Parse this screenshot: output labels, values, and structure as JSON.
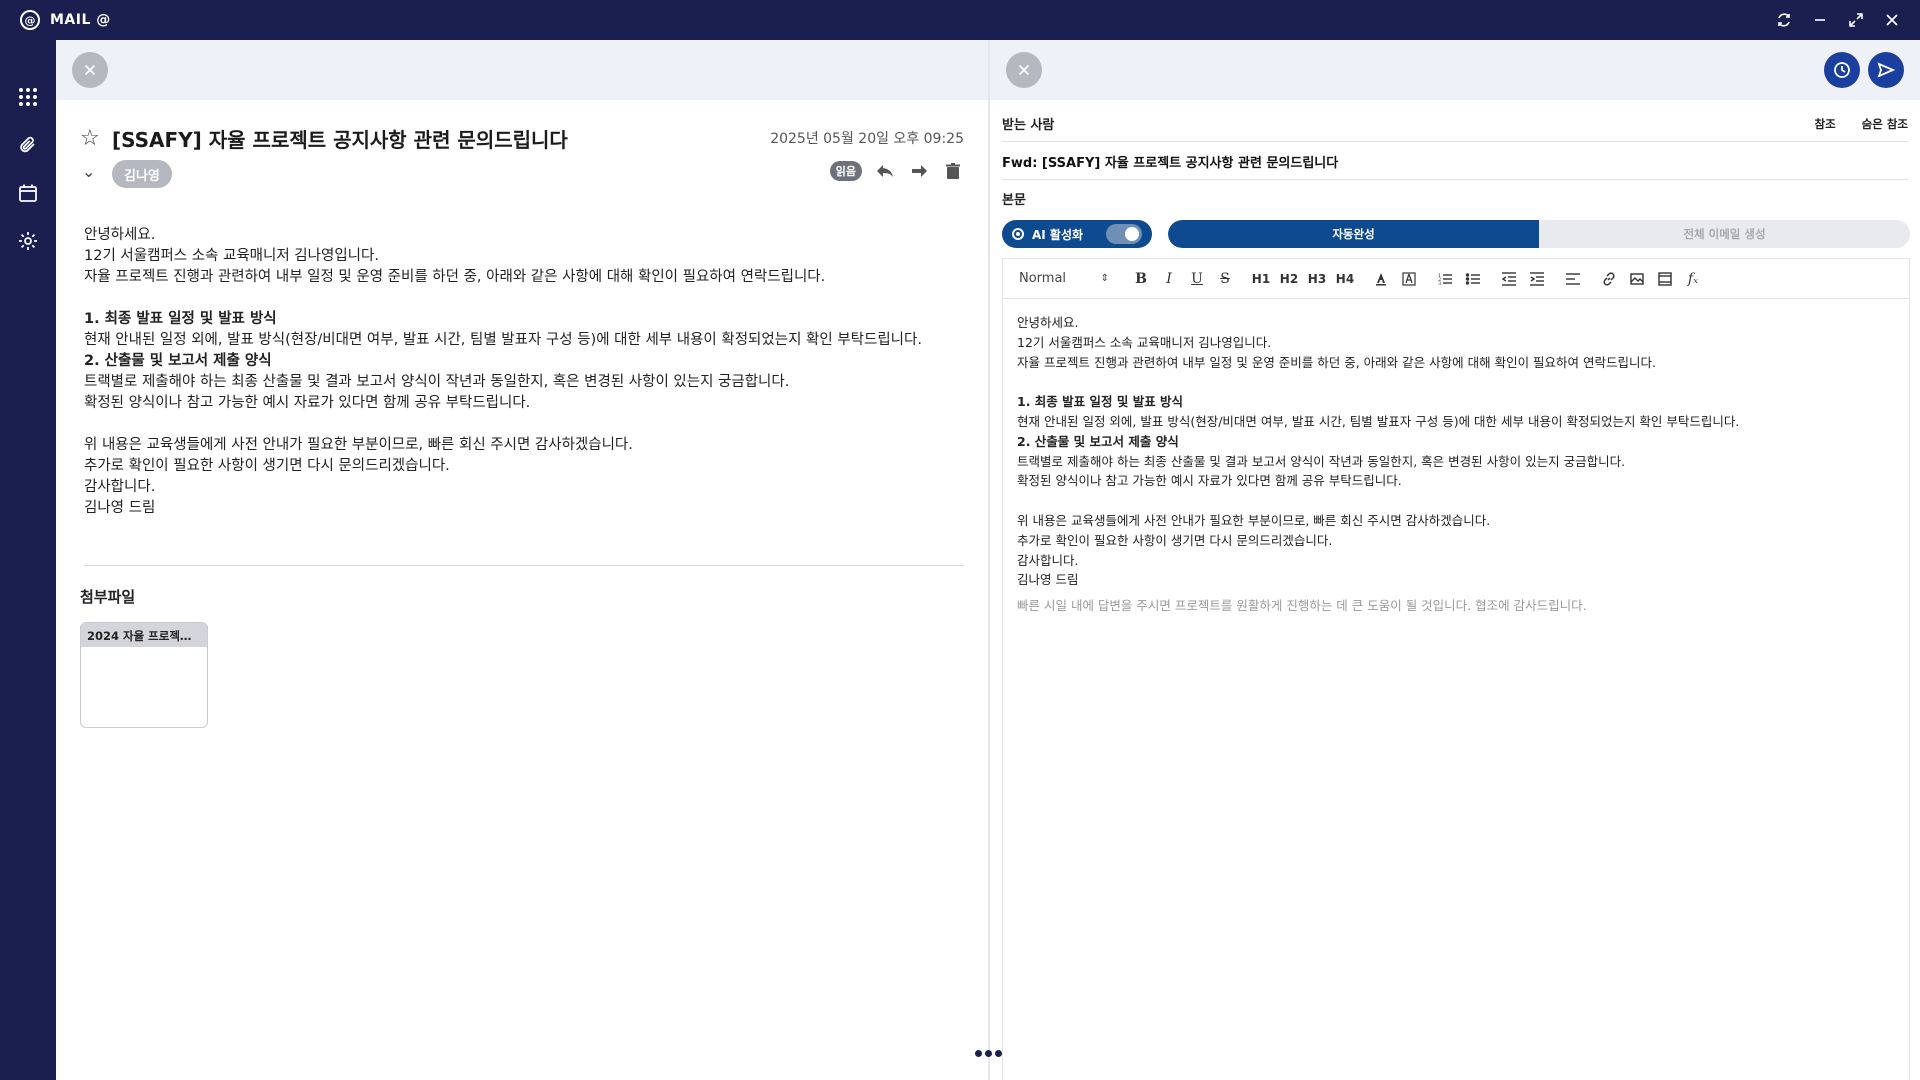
{
  "app": {
    "title": "MAIL @",
    "logo": "@"
  },
  "window_controls": [
    "refresh-icon",
    "minimize-icon",
    "maximize-icon",
    "close-icon"
  ],
  "rail": [
    "apps-grid-icon",
    "paperclip-icon",
    "calendar-icon",
    "gear-icon"
  ],
  "mail": {
    "subject": "[SSAFY] 자율 프로젝트 공지사항 관련 문의드립니다",
    "date": "2025년 05월 20일 오후 09:25",
    "sender": "김나영",
    "read_badge": "읽음",
    "body": [
      {
        "text": "안녕하세요.",
        "bold": false
      },
      {
        "text": "12기 서울캠퍼스 소속 교육매니저 김나영입니다.",
        "bold": false
      },
      {
        "text": "자율 프로젝트 진행과 관련하여 내부 일정 및 운영 준비를 하던 중, 아래와 같은 사항에 대해 확인이 필요하여 연락드립니다.",
        "bold": false
      },
      {
        "text": "",
        "bold": false
      },
      {
        "text": "1. 최종 발표 일정 및 발표 방식",
        "bold": true
      },
      {
        "text": "현재 안내된 일정 외에, 발표 방식(현장/비대면 여부, 발표 시간, 팀별 발표자 구성 등)에 대한 세부 내용이 확정되었는지 확인 부탁드립니다.",
        "bold": false
      },
      {
        "text": "2. 산출물 및 보고서 제출 양식",
        "bold": true
      },
      {
        "text": "트랙별로 제출해야 하는 최종 산출물 및 결과 보고서 양식이 작년과 동일한지, 혹은 변경된 사항이 있는지 궁금합니다.",
        "bold": false
      },
      {
        "text": "확정된 양식이나 참고 가능한 예시 자료가 있다면 함께 공유 부탁드립니다.",
        "bold": false
      },
      {
        "text": "",
        "bold": false
      },
      {
        "text": "위 내용은 교육생들에게 사전 안내가 필요한 부분이므로, 빠른 회신 주시면 감사하겠습니다.",
        "bold": false
      },
      {
        "text": "추가로 확인이 필요한 사항이 생기면 다시 문의드리겠습니다.",
        "bold": false
      },
      {
        "text": "감사합니다.",
        "bold": false
      },
      {
        "text": "김나영 드림",
        "bold": false
      }
    ],
    "attachments_title": "첨부파일",
    "attachments": [
      {
        "name": "2024 자율 프로젝트 ..."
      }
    ]
  },
  "compose": {
    "to_label": "받는 사람",
    "cc_label": "참조",
    "bcc_label": "숨은 참조",
    "subject": "Fwd: [SSAFY] 자율 프로젝트 공지사항 관련 문의드립니다",
    "body_label": "본문",
    "ai_toggle_label": "AI 활성화",
    "ai_enabled": true,
    "tab_autocomplete": "자동완성",
    "tab_full_generate": "전체 이메일 생성",
    "format_select": "Normal",
    "toolbar_headings": [
      "H1",
      "H2",
      "H3",
      "H4"
    ],
    "editor_lines": [
      {
        "text": "안녕하세요.",
        "bold": false
      },
      {
        "text": " 12기 서울캠퍼스 소속 교육매니저 김나영입니다.",
        "bold": false
      },
      {
        "text": "자율 프로젝트 진행과 관련하여 내부 일정 및 운영 준비를 하던 중, 아래와 같은 사항에 대해 확인이 필요하여 연락드립니다.",
        "bold": false
      },
      {
        "text": "",
        "bold": false
      },
      {
        "text": "1. 최종 발표 일정 및 발표 방식",
        "bold": true
      },
      {
        "text": " 현재 안내된 일정 외에, 발표 방식(현장/비대면 여부, 발표 시간, 팀별 발표자 구성 등)에 대한 세부 내용이 확정되었는지 확인 부탁드립니다.",
        "bold": false
      },
      {
        "text": "2. 산출물 및 보고서 제출 양식",
        "bold": true
      },
      {
        "text": " 트랙별로 제출해야 하는 최종 산출물 및 결과 보고서 양식이 작년과 동일한지, 혹은 변경된 사항이 있는지 궁금합니다.",
        "bold": false
      },
      {
        "text": " 확정된 양식이나 참고 가능한 예시 자료가 있다면 함께 공유 부탁드립니다.",
        "bold": false
      },
      {
        "text": "",
        "bold": false
      },
      {
        "text": "위 내용은 교육생들에게 사전 안내가 필요한 부분이므로, 빠른 회신 주시면 감사하겠습니다.",
        "bold": false
      },
      {
        "text": " 추가로 확인이 필요한 사항이 생기면 다시 문의드리겠습니다.",
        "bold": false
      },
      {
        "text": "감사합니다.",
        "bold": false
      },
      {
        "text": " 김나영 드림",
        "bold": false
      }
    ],
    "ai_suggestion": "빠른 시일 내에 답변을 주시면 프로젝트를 원활하게 진행하는 데 큰 도움이 될 것입니다. 협조에 감사드립니다."
  },
  "colors": {
    "navy": "#1a1f4f",
    "accent": "#0d4a8f",
    "send": "#1b3f9e"
  }
}
